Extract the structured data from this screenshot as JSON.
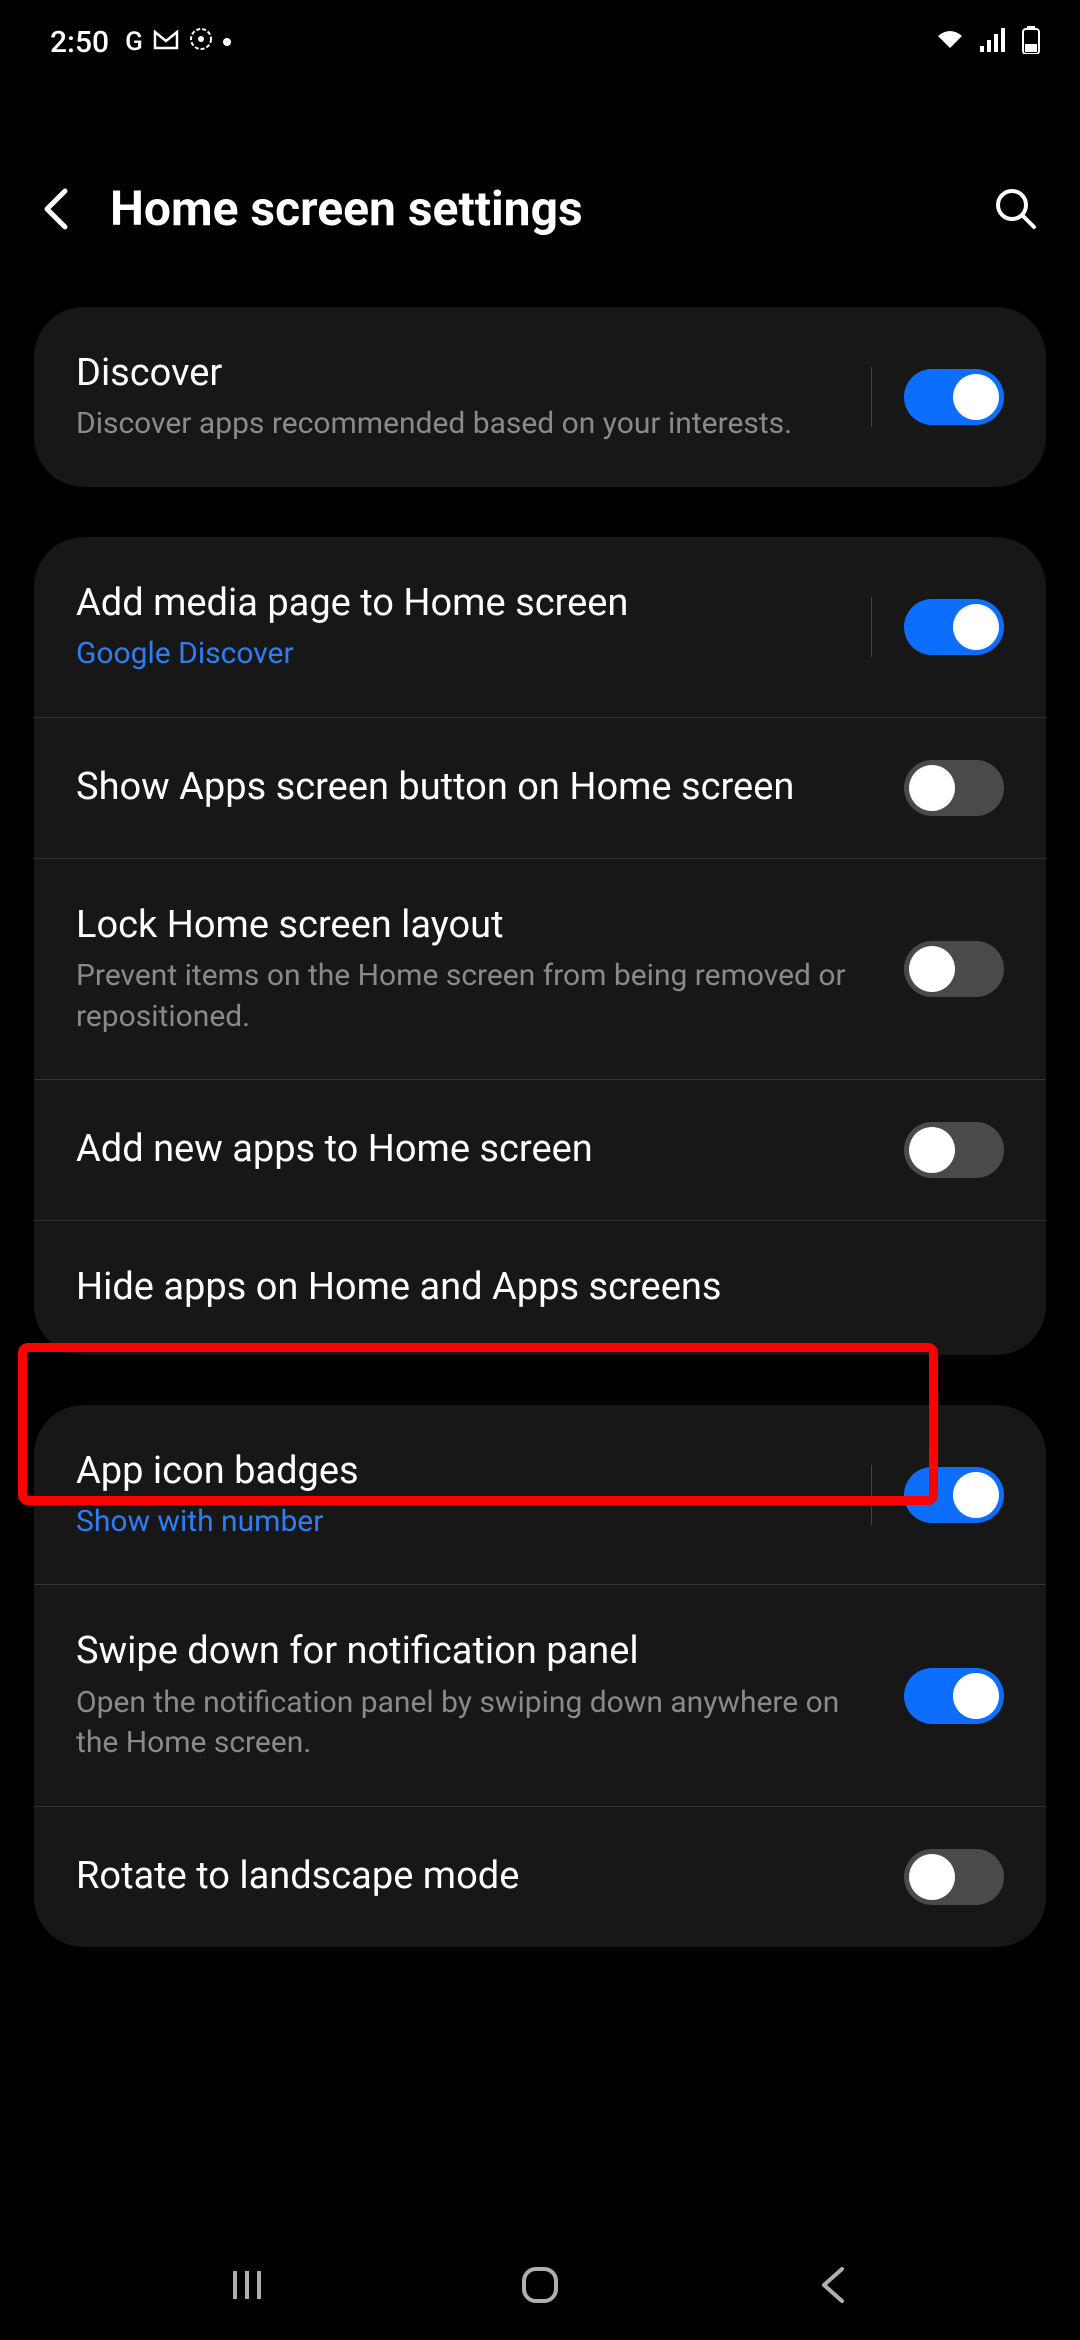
{
  "status": {
    "time": "2:50",
    "icons_left": "G"
  },
  "header": {
    "title": "Home screen settings"
  },
  "group1": {
    "discover": {
      "title": "Discover",
      "subtitle": "Discover apps recommended based on your interests.",
      "enabled": true
    }
  },
  "group2": {
    "media_page": {
      "title": "Add media page to Home screen",
      "subtitle": "Google Discover",
      "enabled": true
    },
    "apps_button": {
      "title": "Show Apps screen button on Home screen",
      "enabled": false
    },
    "lock_layout": {
      "title": "Lock Home screen layout",
      "subtitle": "Prevent items on the Home screen from being removed or repositioned.",
      "enabled": false
    },
    "add_new_apps": {
      "title": "Add new apps to Home screen",
      "enabled": false
    },
    "hide_apps": {
      "title": "Hide apps on Home and Apps screens"
    }
  },
  "group3": {
    "badges": {
      "title": "App icon badges",
      "subtitle": "Show with number",
      "enabled": true
    },
    "swipe_down": {
      "title": "Swipe down for notification panel",
      "subtitle": "Open the notification panel by swiping down anywhere on the Home screen.",
      "enabled": true
    },
    "rotate": {
      "title": "Rotate to landscape mode",
      "enabled": false
    }
  }
}
